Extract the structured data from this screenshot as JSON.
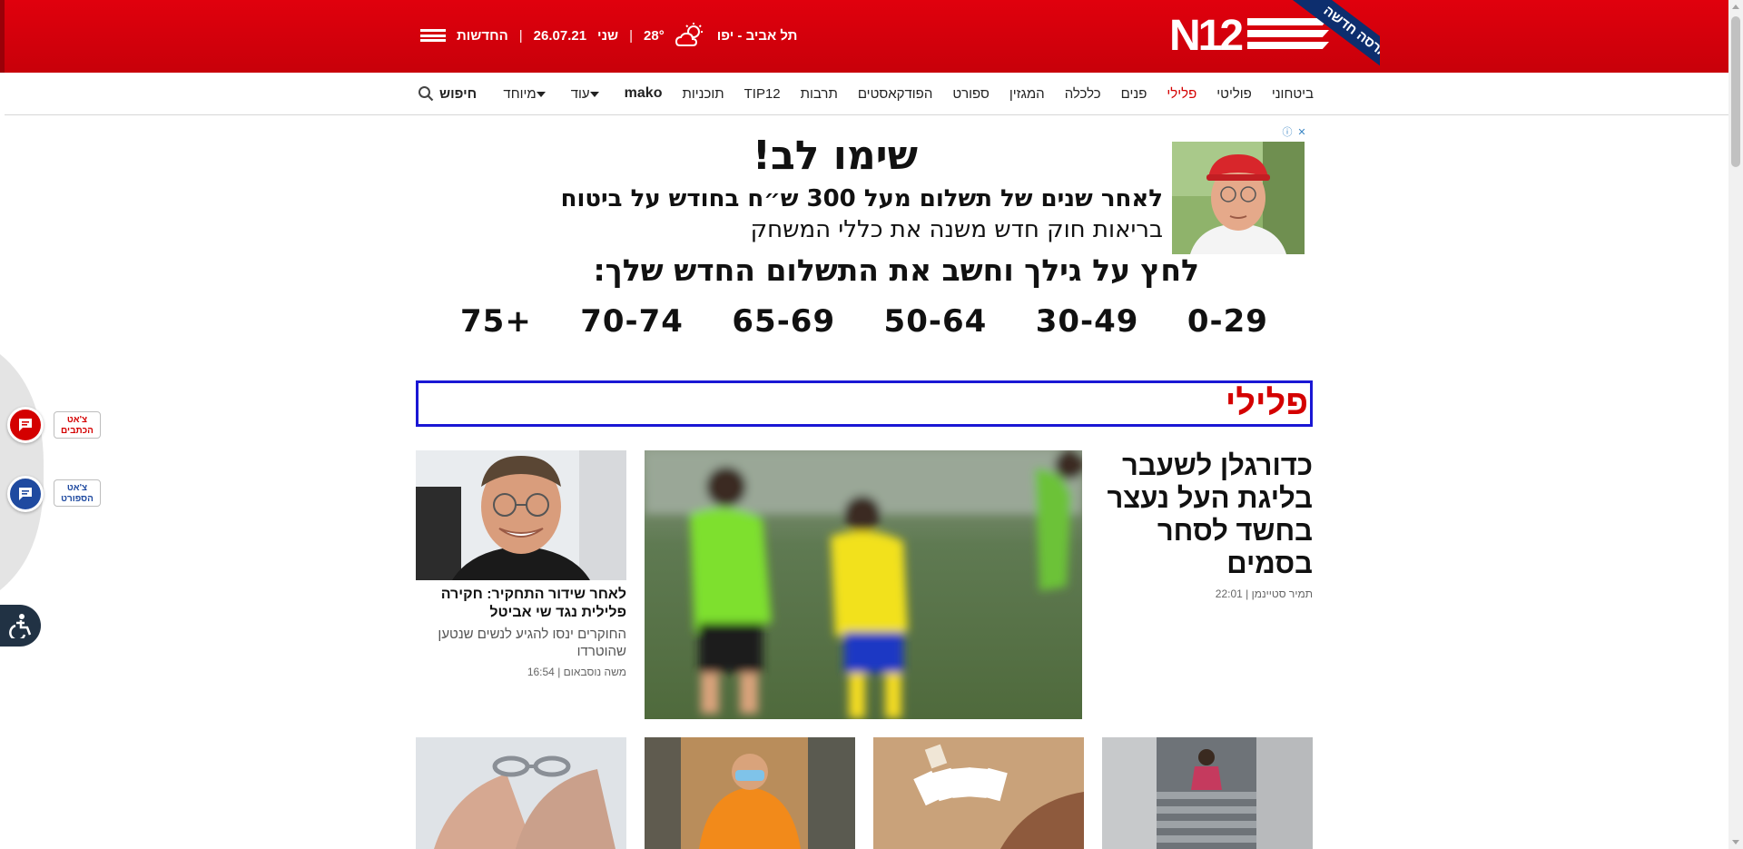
{
  "header": {
    "logo_text": "N12",
    "ribbon_text": "גרסה חדשה",
    "location": "תל אביב - יפו",
    "temperature": "28°",
    "day": "שני",
    "date": "26.07.21",
    "separator": "|",
    "news_menu_label": "החדשות",
    "brand_color": "#e0000d"
  },
  "nav": {
    "items": [
      {
        "label": "ביטחוני",
        "active": false
      },
      {
        "label": "פוליטי",
        "active": false
      },
      {
        "label": "פלילי",
        "active": true
      },
      {
        "label": "פנים",
        "active": false
      },
      {
        "label": "כלכלה",
        "active": false
      },
      {
        "label": "המגזין",
        "active": false
      },
      {
        "label": "ספורט",
        "active": false
      },
      {
        "label": "הפודקאסטים",
        "active": false
      },
      {
        "label": "תרבות",
        "active": false
      },
      {
        "label": "TIP12",
        "active": false
      },
      {
        "label": "תוכניות",
        "active": false
      },
      {
        "label": "mako",
        "active": false
      },
      {
        "label": "עוד",
        "active": false,
        "dropdown": true
      },
      {
        "label": "מיוחד",
        "active": false,
        "dropdown": true
      }
    ],
    "search_label": "חיפוש"
  },
  "ad": {
    "title": "שימו לב!",
    "line1": "לאחר שנים של תשלום מעל 300 ש״ח בחודש על ביטוח",
    "line2": "בריאות חוק חדש משנה את כללי המשחק",
    "cta": "לחץ על גילך וחשב את התשלום החדש שלך:",
    "ages": [
      "75+",
      "70-74",
      "65-69",
      "50-64",
      "30-49",
      "0-29"
    ],
    "close_icons": [
      "ⓘ",
      "✕"
    ]
  },
  "section": {
    "title": "פלילי",
    "title_color": "#d40000",
    "border_color": "#1a17d4"
  },
  "main_article": {
    "title": "כדורגלן לשעבר בליגת העל נעצר בחשד לסחר בסמים",
    "author": "תמיר סטיינמן",
    "time": "22:01",
    "separator": "|"
  },
  "side_article": {
    "title": "לאחר שידור התחקיר: חקירה פלילית נגד שי אביטל",
    "subtitle": "החוקרים ינסו להגיע לנשים שנטען שהוטרדו",
    "author": "משה נוסבאום",
    "time": "16:54",
    "separator": "|"
  },
  "floating": {
    "chat_writers_line1": "צ'אט",
    "chat_writers_line2": "הכתבים",
    "chat_sport_line1": "צ'אט",
    "chat_sport_line2": "הספורט"
  }
}
